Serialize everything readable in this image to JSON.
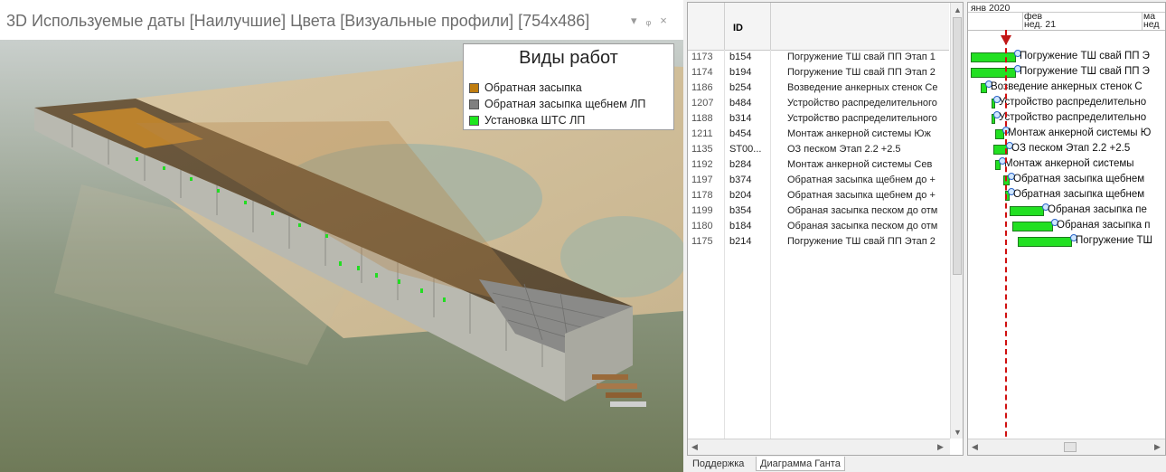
{
  "window": {
    "title": "3D Используемые даты [Наилучшие] Цвета [Визуальные профили]  [754x486]",
    "pin_glyph": "▾",
    "dock_glyph": "ᵩ",
    "close_glyph": "×"
  },
  "legend": {
    "title": "Виды работ",
    "items": [
      {
        "label": "Обратная засыпка",
        "color": "#c07d0f"
      },
      {
        "label": "Обратная засыпка щебнем ЛП",
        "color": "#808080"
      },
      {
        "label": "Установка ШТС ЛП",
        "color": "#1ee61e"
      }
    ]
  },
  "grid": {
    "header_id": "ID",
    "rows": [
      {
        "n": "1173",
        "id": "b154",
        "name": "Погружение ТШ свай ПП Этап 1"
      },
      {
        "n": "1174",
        "id": "b194",
        "name": "Погружение ТШ свай ПП Этап 2"
      },
      {
        "n": "1186",
        "id": "b254",
        "name": "Возведение анкерных стенок Се"
      },
      {
        "n": "1207",
        "id": "b484",
        "name": "Устройство распределительного"
      },
      {
        "n": "1188",
        "id": "b314",
        "name": "Устройство распределительного"
      },
      {
        "n": "1211",
        "id": "b454",
        "name": "Монтаж анкерной системы  Юж"
      },
      {
        "n": "1135",
        "id": "ST00...",
        "name": "ОЗ песком Этап 2.2 +2.5"
      },
      {
        "n": "1192",
        "id": "b284",
        "name": "Монтаж анкерной системы  Сев"
      },
      {
        "n": "1197",
        "id": "b374",
        "name": "Обратная засыпка щебнем до +"
      },
      {
        "n": "1178",
        "id": "b204",
        "name": "Обратная засыпка щебнем до +"
      },
      {
        "n": "1199",
        "id": "b354",
        "name": "Обраная засыпка песком до отм"
      },
      {
        "n": "1180",
        "id": "b184",
        "name": "Обраная засыпка песком до отм"
      },
      {
        "n": "1175",
        "id": "b214",
        "name": "Погружение ТШ свай ПП Этап 2"
      }
    ]
  },
  "gantt": {
    "month1": "янв 2020",
    "month2": "фев",
    "month3": "ма",
    "week1": "нед. 21",
    "week2": "нед",
    "rows": [
      {
        "label": "Погружение ТШ свай ПП Э"
      },
      {
        "label": "Погружение ТШ свай ПП Э"
      },
      {
        "label": "Возведение анкерных стенок С"
      },
      {
        "label": "Устройство распределительно"
      },
      {
        "label": "Устройство распределительно"
      },
      {
        "label": "Монтаж анкерной системы  Ю"
      },
      {
        "label": "ОЗ песком Этап 2.2 +2.5"
      },
      {
        "label": "Монтаж анкерной системы"
      },
      {
        "label": "Обратная засыпка щебнем"
      },
      {
        "label": "Обратная засыпка щебнем"
      },
      {
        "label": "Обраная засыпка пе"
      },
      {
        "label": "Обраная засыпка п"
      },
      {
        "label": "Погружение ТШ"
      }
    ]
  },
  "tabs": {
    "support": "Поддержка",
    "gantt": "Диаграмма Ганта"
  }
}
